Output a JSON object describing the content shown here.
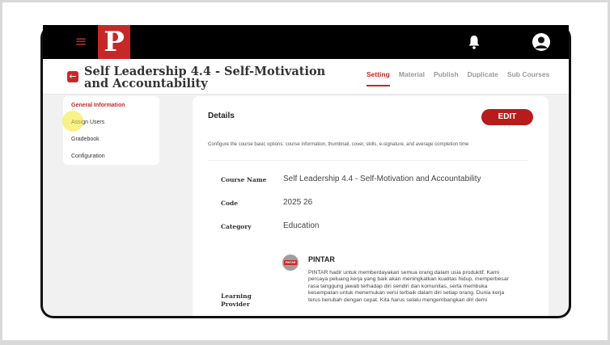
{
  "header": {
    "menu_icon": "menu-icon",
    "logo_letter": "P",
    "bell_icon": "bell-icon",
    "avatar_icon": "user-avatar-icon"
  },
  "course": {
    "title": "Self Leadership 4.4 - Self-Motivation and Accountability",
    "back_icon": "arrow-left-icon"
  },
  "tabs": [
    {
      "label": "Setting",
      "active": true
    },
    {
      "label": "Material"
    },
    {
      "label": "Publish"
    },
    {
      "label": "Duplicate"
    },
    {
      "label": "Sub Courses"
    }
  ],
  "sidebar": {
    "items": [
      {
        "label": "General Information",
        "active": true
      },
      {
        "label": "Assign Users"
      },
      {
        "label": "Gradebook"
      },
      {
        "label": "Configuration"
      }
    ]
  },
  "details": {
    "title": "Details",
    "edit_label": "EDIT",
    "description": "Configure the course basic options: course information, thumbnail, cover, skills, e-signature, and average completion time",
    "fields": [
      {
        "label": "Course Name",
        "value": "Self Leadership 4.4 - Self-Motivation and Accountability"
      },
      {
        "label": "Code",
        "value": "2025 26"
      },
      {
        "label": "Category",
        "value": "Education"
      },
      {
        "label": "Learning Provider"
      }
    ],
    "provider": {
      "badge": "PINTAR",
      "name": "PINTAR",
      "description": "PINTAR hadir untuk memberdayakan semua orang dalam usia produktif. Kami percaya peluang kerja yang baik akan meningkatkan kualitas hidup, memperbesar rasa tanggung jawab terhadap diri sendiri dan komunitas, serta membuka kesempatan untuk menemukan versi terbaik dalam diri setiap orang. Dunia kerja terus berubah dengan cepat. Kita harus selalu mengembangkan diri demi"
    }
  },
  "colors": {
    "accent": "#c62828",
    "edit_button": "#b71c1c",
    "topbar": "#000000"
  }
}
